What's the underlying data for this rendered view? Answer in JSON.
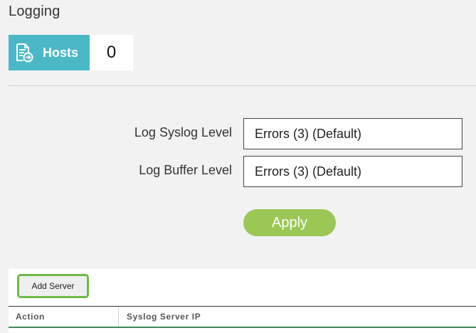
{
  "page": {
    "title": "Logging"
  },
  "hosts_tile": {
    "icon": "document-arrow-icon",
    "label": "Hosts",
    "count": "0",
    "color": "#4ab8c6"
  },
  "form": {
    "syslog_level": {
      "label": "Log Syslog Level",
      "value": "Errors (3) (Default)"
    },
    "buffer_level": {
      "label": "Log Buffer Level",
      "value": "Errors (3) (Default)"
    },
    "apply_label": "Apply",
    "apply_color": "#9bc755"
  },
  "servers": {
    "add_button_label": "Add Server",
    "columns": [
      "Action",
      "Syslog Server IP"
    ],
    "rows": []
  }
}
